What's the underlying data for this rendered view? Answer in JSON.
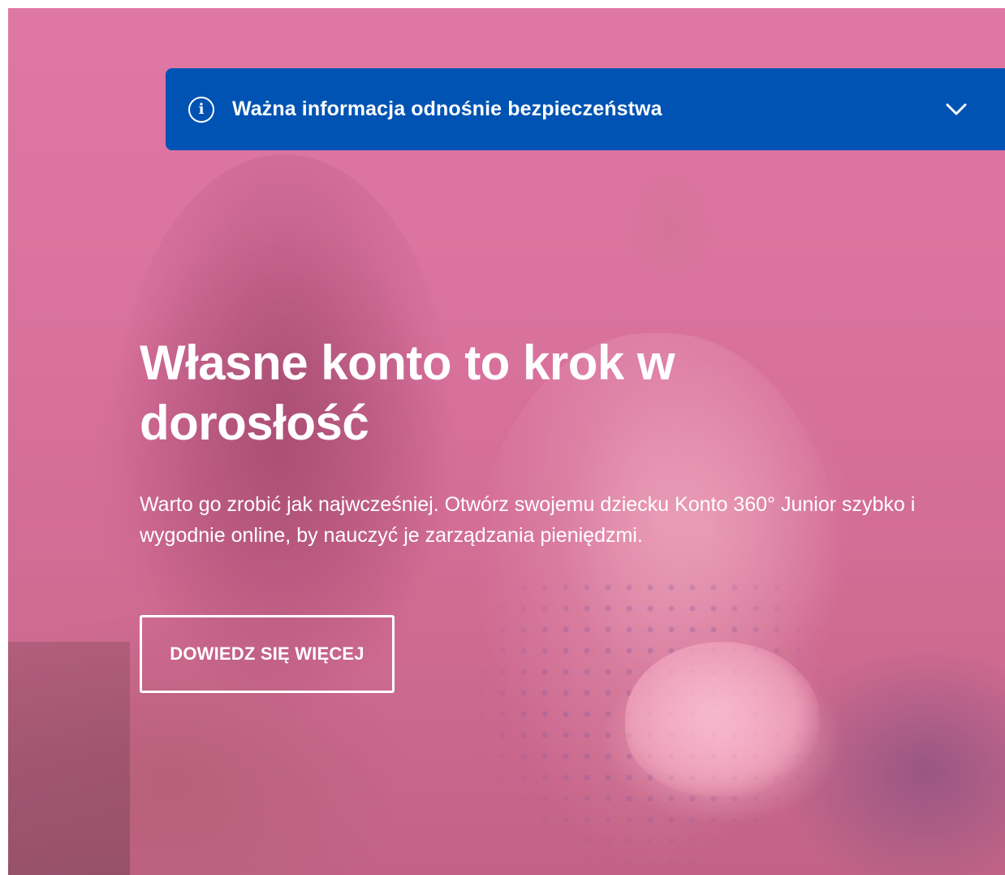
{
  "notice": {
    "icon": "info-icon",
    "icon_glyph": "i",
    "text": "Ważna informacja odnośnie bezpieczeństwa",
    "chevron_icon": "chevron-down-icon",
    "background_color": "#0053b3"
  },
  "hero": {
    "title": "Własne konto to krok w dorosłość",
    "description": "Warto go zrobić jak najwcześniej. Otwórz swojemu dziecku Konto 360° Junior szybko i wygodnie online, by nauczyć je zarządzania pieniędzmi.",
    "button_label": "DOWIEDZ SIĘ WIĘCEJ",
    "overlay_color": "#d9779f"
  }
}
